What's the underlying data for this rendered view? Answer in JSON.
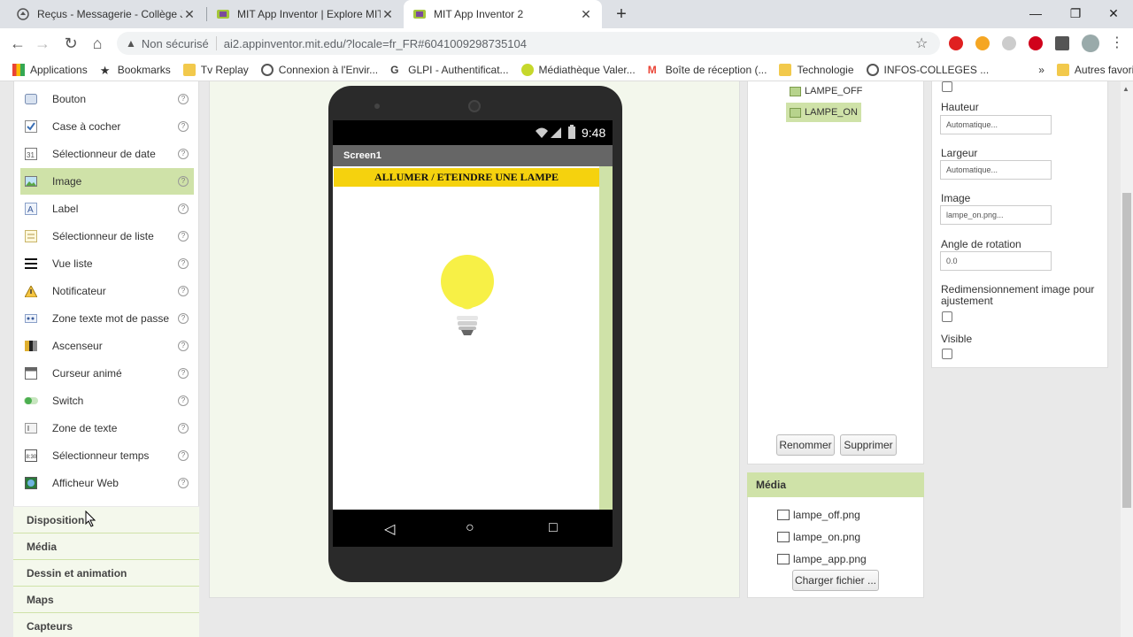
{
  "browser": {
    "tabs": [
      {
        "title": "Reçus - Messagerie - Collège Jule",
        "icon": "mail-icon"
      },
      {
        "title": "MIT App Inventor | Explore MIT A",
        "icon": "app-inventor-icon"
      },
      {
        "title": "MIT App Inventor 2",
        "icon": "app-inventor-icon"
      }
    ],
    "new_tab": "+",
    "address": {
      "warning": "Non sécurisé",
      "url": "ai2.appinventor.mit.edu/?locale=fr_FR#6041009298735104"
    },
    "bookmarks": [
      "Applications",
      "Bookmarks",
      "Tv Replay",
      "Connexion à l'Envir...",
      "GLPI - Authentificat...",
      "Médiathèque Valer...",
      "Boîte de réception (...",
      "Technologie",
      "INFOS-COLLEGES ...",
      "Autres favoris"
    ],
    "more_bookmarks": "»"
  },
  "palette": {
    "items": [
      {
        "label": "Bouton",
        "icon": "button-icon"
      },
      {
        "label": "Case à cocher",
        "icon": "checkbox-icon"
      },
      {
        "label": "Sélectionneur de date",
        "icon": "datepicker-icon"
      },
      {
        "label": "Image",
        "icon": "image-icon",
        "selected": true
      },
      {
        "label": "Label",
        "icon": "label-icon"
      },
      {
        "label": "Sélectionneur de liste",
        "icon": "listpicker-icon"
      },
      {
        "label": "Vue liste",
        "icon": "listview-icon"
      },
      {
        "label": "Notificateur",
        "icon": "notifier-icon"
      },
      {
        "label": "Zone texte mot de passe",
        "icon": "password-icon"
      },
      {
        "label": "Ascenseur",
        "icon": "slider-icon"
      },
      {
        "label": "Curseur animé",
        "icon": "spinner-icon"
      },
      {
        "label": "Switch",
        "icon": "switch-icon"
      },
      {
        "label": "Zone de texte",
        "icon": "textbox-icon"
      },
      {
        "label": "Sélectionneur temps",
        "icon": "timepicker-icon"
      },
      {
        "label": "Afficheur Web",
        "icon": "webviewer-icon"
      }
    ],
    "help": "?",
    "drawers": [
      "Disposition",
      "Média",
      "Dessin et animation",
      "Maps",
      "Capteurs"
    ]
  },
  "viewer": {
    "time": "9:48",
    "screen_title": "Screen1",
    "label_text": "ALLUMER / ETEINDRE UNE LAMPE"
  },
  "components": {
    "items": [
      {
        "label": "LAMPE_OFF",
        "selected": false
      },
      {
        "label": "LAMPE_ON",
        "selected": true
      }
    ],
    "rename": "Renommer",
    "delete": "Supprimer"
  },
  "media": {
    "title": "Média",
    "files": [
      "lampe_off.png",
      "lampe_on.png",
      "lampe_app.png"
    ],
    "upload": "Charger fichier ..."
  },
  "properties": {
    "height_label": "Hauteur",
    "height_value": "Automatique...",
    "width_label": "Largeur",
    "width_value": "Automatique...",
    "image_label": "Image",
    "image_value": "lampe_on.png...",
    "rotation_label": "Angle de rotation",
    "rotation_value": "0.0",
    "scale_label": "Redimensionnement image pour ajustement",
    "visible_label": "Visible"
  }
}
